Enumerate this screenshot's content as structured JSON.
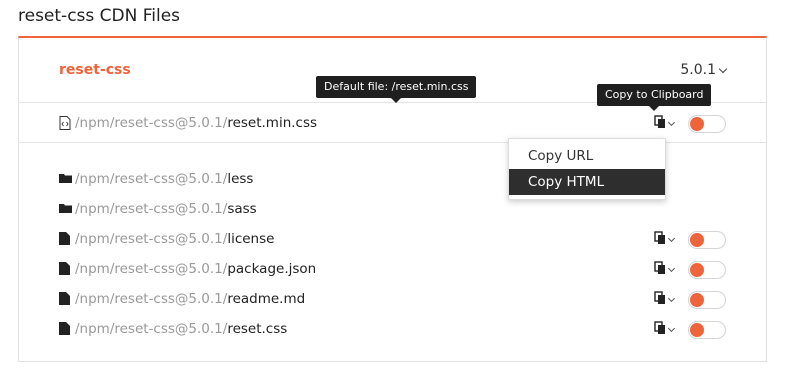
{
  "page": {
    "title": "reset-css CDN Files"
  },
  "package": {
    "name": "reset-css",
    "version": "5.0.1"
  },
  "tooltips": {
    "default_file": "Default file: /reset.min.css",
    "copy": "Copy to Clipboard"
  },
  "main_file": {
    "prefix": "/npm/reset-css@5.0.1/",
    "name": "reset.min.css",
    "icon": "code-file-icon"
  },
  "menu": {
    "items": [
      "Copy URL",
      "Copy HTML"
    ],
    "active": "Copy HTML"
  },
  "files": [
    {
      "prefix": "/npm/reset-css@5.0.1/",
      "name": "less",
      "type": "folder"
    },
    {
      "prefix": "/npm/reset-css@5.0.1/",
      "name": "sass",
      "type": "folder"
    },
    {
      "prefix": "/npm/reset-css@5.0.1/",
      "name": "license",
      "type": "file"
    },
    {
      "prefix": "/npm/reset-css@5.0.1/",
      "name": "package.json",
      "type": "file"
    },
    {
      "prefix": "/npm/reset-css@5.0.1/",
      "name": "readme.md",
      "type": "file"
    },
    {
      "prefix": "/npm/reset-css@5.0.1/",
      "name": "reset.css",
      "type": "file"
    }
  ],
  "colors": {
    "accent": "#f0643c",
    "tooltip_bg": "#1f1f1f",
    "muted": "#999999"
  }
}
